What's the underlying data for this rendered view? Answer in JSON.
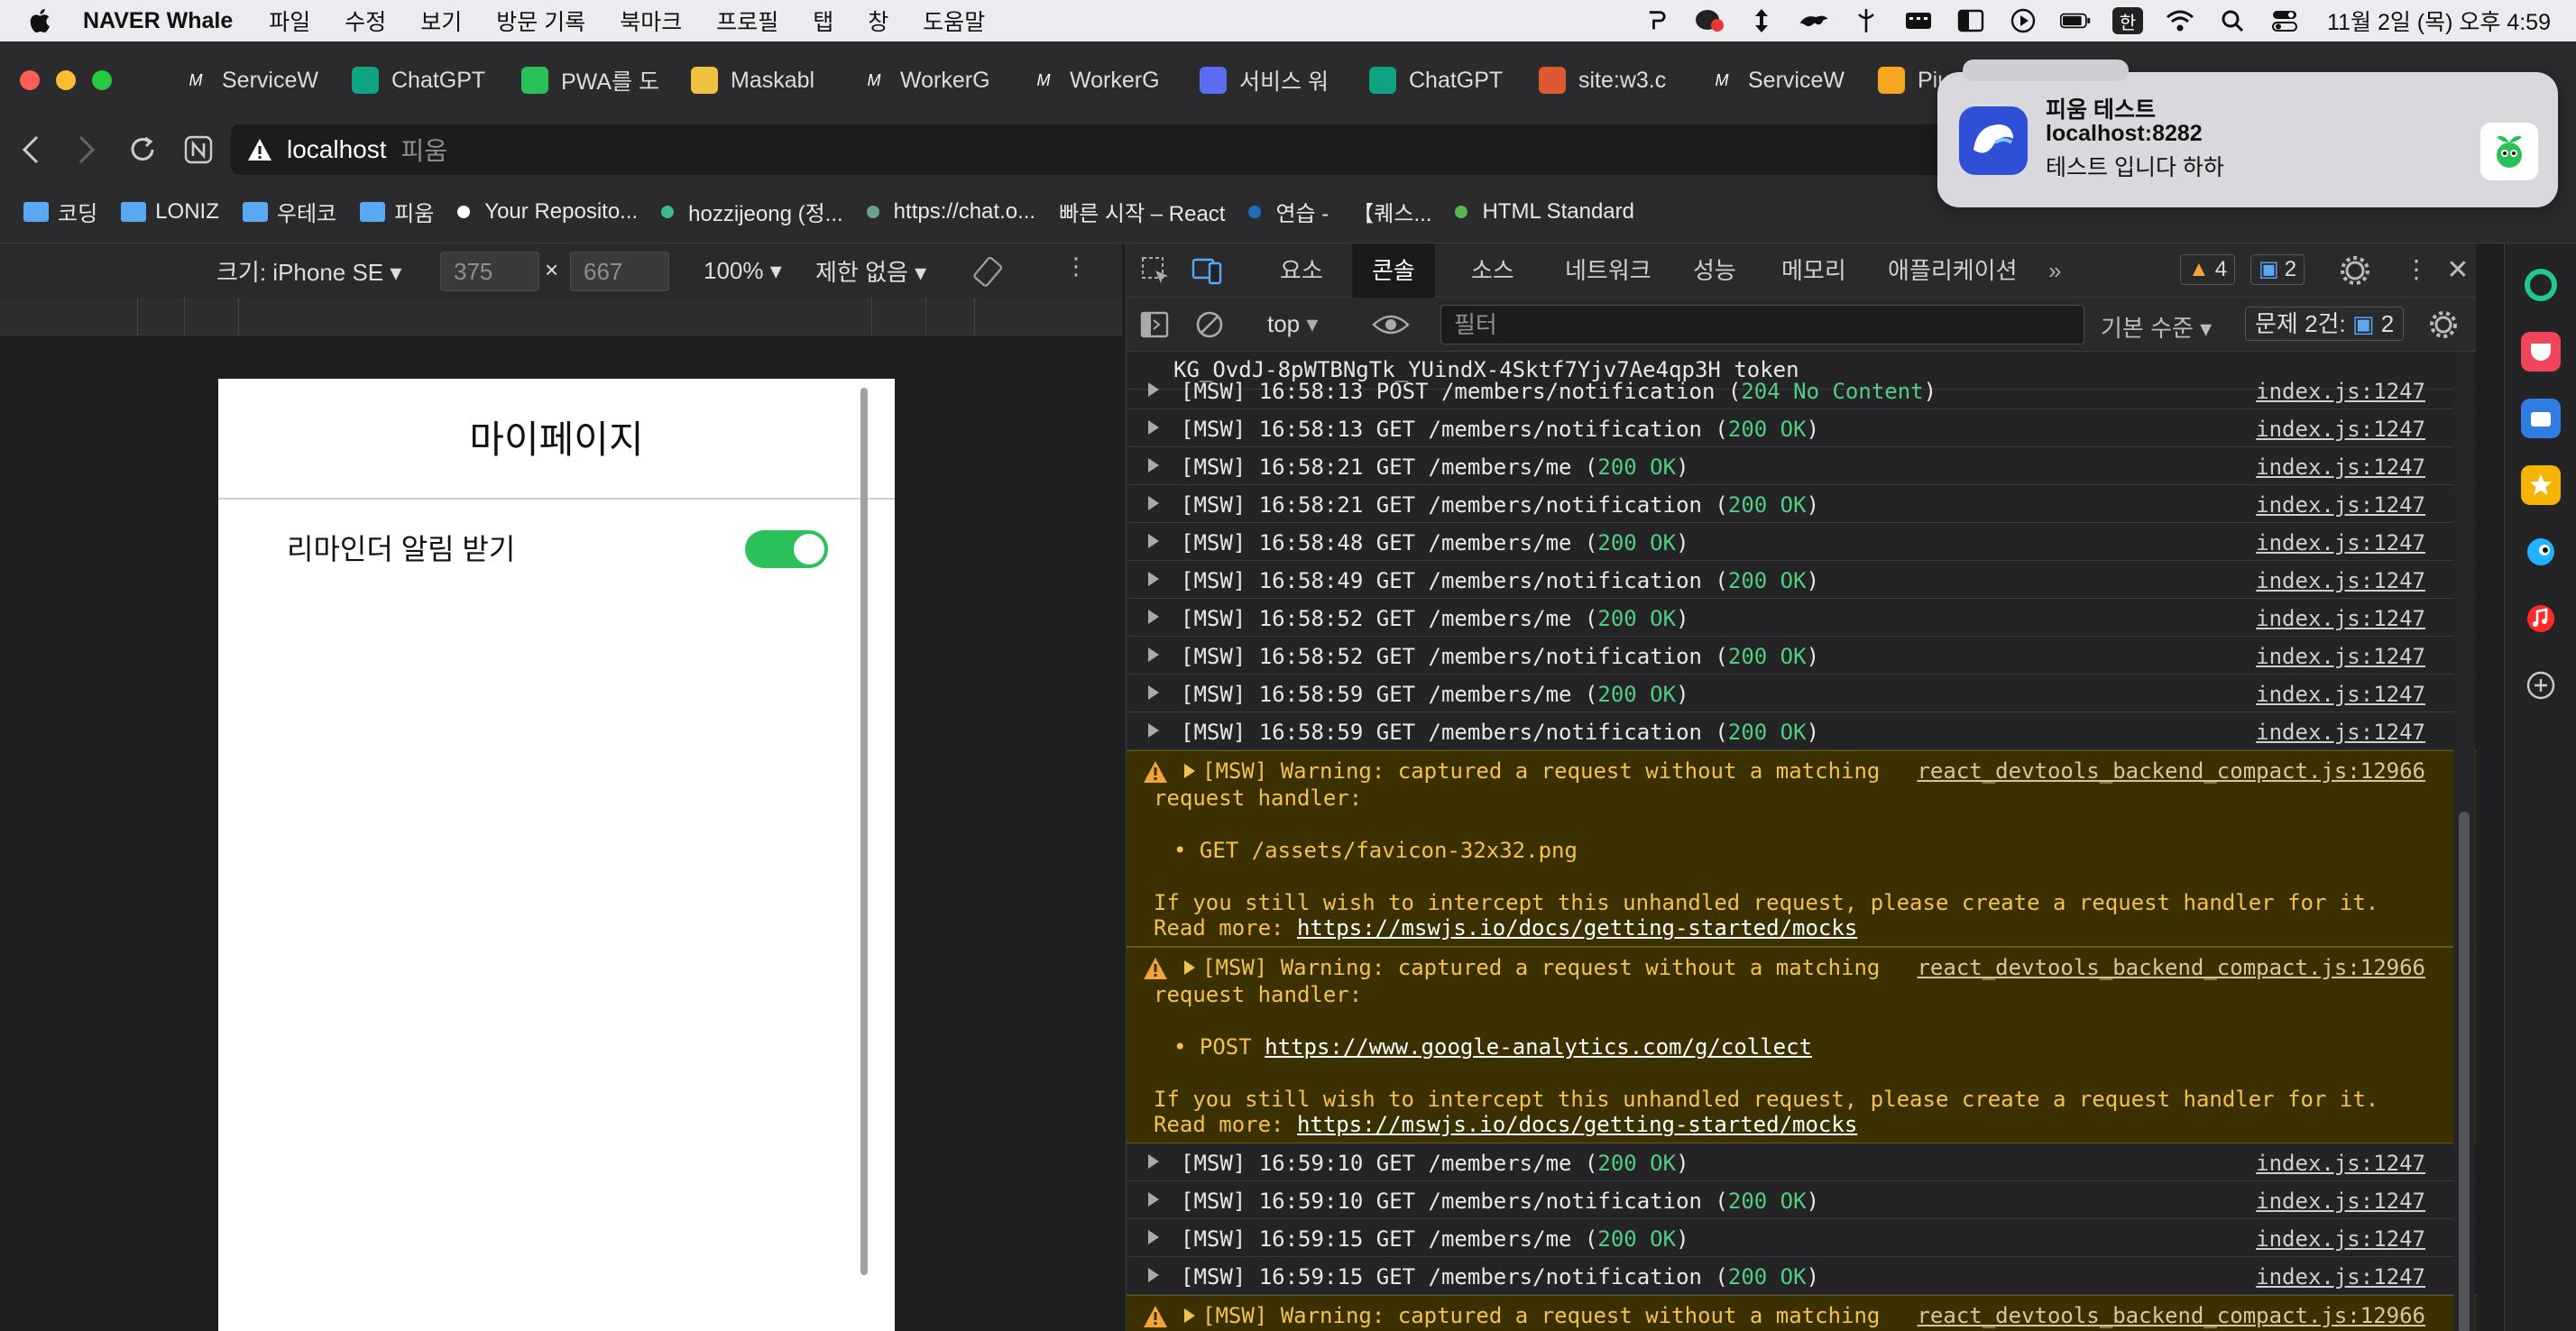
{
  "menubar": {
    "app_name": "NAVER Whale",
    "items": [
      "파일",
      "수정",
      "보기",
      "방문 기록",
      "북마크",
      "프로필",
      "탭",
      "창",
      "도움말"
    ],
    "clock": "11월 2일 (목) 오후 4:59",
    "ime": "한"
  },
  "tabs": [
    {
      "label": "ServiceW",
      "icon": "workerg-logo-icon",
      "color": "#2b2b2e"
    },
    {
      "label": "ChatGPT",
      "icon": "chatgpt-icon",
      "color": "#10a37f"
    },
    {
      "label": "PWA를 도",
      "icon": "pium-icon",
      "color": "#2bc15a"
    },
    {
      "label": "Maskabl",
      "icon": "maskable-icon",
      "color": "#f0c040"
    },
    {
      "label": "WorkerG",
      "icon": "workerg-logo-icon",
      "color": "#2b2b2e"
    },
    {
      "label": "WorkerG",
      "icon": "workerg-logo-icon",
      "color": "#2b2b2e"
    },
    {
      "label": "서비스 워",
      "icon": "arrow-logo-icon",
      "color": "#5a6cf0"
    },
    {
      "label": "ChatGPT",
      "icon": "chatgpt-icon",
      "color": "#10a37f"
    },
    {
      "label": "site:w3.c",
      "icon": "duckduckgo-icon",
      "color": "#de5833"
    },
    {
      "label": "ServiceW",
      "icon": "workerg-logo-icon",
      "color": "#2b2b2e"
    },
    {
      "label": "Pium - ",
      "icon": "firebase-icon",
      "color": "#f5a623"
    }
  ],
  "address": {
    "host": "localhost",
    "title": "피움"
  },
  "bookmarks": [
    {
      "label": "코딩",
      "type": "folder"
    },
    {
      "label": "LONIZ",
      "type": "folder"
    },
    {
      "label": "우테코",
      "type": "folder"
    },
    {
      "label": "피움",
      "type": "folder"
    },
    {
      "label": "Your Reposito...",
      "type": "dot",
      "color": "#ffffff"
    },
    {
      "label": "hozzijeong (정...",
      "type": "dot",
      "color": "#3fb98a"
    },
    {
      "label": "https://chat.o...",
      "type": "dot",
      "color": "#6aa28f"
    },
    {
      "label": "빠른 시작 – React",
      "type": "none"
    },
    {
      "label": "연습 - ",
      "type": "dot",
      "color": "#1e6fb8"
    },
    {
      "label": "【퀘스...",
      "type": "none"
    },
    {
      "label": "HTML Standard",
      "type": "dot",
      "color": "#5ab552"
    }
  ],
  "notification": {
    "title": "피움 테스트",
    "subtitle": "localhost:8282",
    "body": "테스트 입니다 하하"
  },
  "device_toolbar": {
    "size_label": "크기: iPhone SE",
    "width": "375",
    "height": "667",
    "zoom": "100%",
    "throttle": "제한 없음"
  },
  "phone": {
    "title": "마이페이지",
    "reminder_label": "리마인더 알림 받기",
    "reminder_on": true
  },
  "devtools": {
    "tabs": [
      "요소",
      "콘솔",
      "소스",
      "네트워크",
      "성능",
      "메모리",
      "애플리케이션"
    ],
    "active_tab": "콘솔",
    "warn_count": "4",
    "msg_count": "2",
    "context": "top",
    "filter_placeholder": "필터",
    "level": "기본 수준",
    "issues_label": "문제 2건:",
    "issues_count": "2"
  },
  "console": {
    "token_line": "KG_OvdJ-8pWTBNgTk_YUindX-4Sktf7Yjv7Ae4qp3H token",
    "logs_a": [
      {
        "text": "[MSW] 16:58:13 POST /members/notification (",
        "status": "204 No Content",
        "tail": ")",
        "src": "index.js:1247"
      },
      {
        "text": "[MSW] 16:58:13 GET /members/notification (",
        "status": "200 OK",
        "tail": ")",
        "src": "index.js:1247"
      },
      {
        "text": "[MSW] 16:58:21 GET /members/me (",
        "status": "200 OK",
        "tail": ")",
        "src": "index.js:1247"
      },
      {
        "text": "[MSW] 16:58:21 GET /members/notification (",
        "status": "200 OK",
        "tail": ")",
        "src": "index.js:1247"
      },
      {
        "text": "[MSW] 16:58:48 GET /members/me (",
        "status": "200 OK",
        "tail": ")",
        "src": "index.js:1247"
      },
      {
        "text": "[MSW] 16:58:49 GET /members/notification (",
        "status": "200 OK",
        "tail": ")",
        "src": "index.js:1247"
      },
      {
        "text": "[MSW] 16:58:52 GET /members/me (",
        "status": "200 OK",
        "tail": ")",
        "src": "index.js:1247"
      },
      {
        "text": "[MSW] 16:58:52 GET /members/notification (",
        "status": "200 OK",
        "tail": ")",
        "src": "index.js:1247"
      },
      {
        "text": "[MSW] 16:58:59 GET /members/me (",
        "status": "200 OK",
        "tail": ")",
        "src": "index.js:1247"
      },
      {
        "text": "[MSW] 16:58:59 GET /members/notification (",
        "status": "200 OK",
        "tail": ")",
        "src": "index.js:1247"
      }
    ],
    "warn1": {
      "line1": "[MSW] Warning: captured a request without a matching",
      "line2": "request handler:",
      "bullet": "• GET /assets/favicon-32x32.png",
      "bullet_link": "",
      "line3": "If you still wish to intercept this unhandled request, please create a request handler for it.",
      "read_more": "Read more: ",
      "link": "https://mswjs.io/docs/getting-started/mocks",
      "src": "react_devtools_backend_compact.js:12966"
    },
    "warn2": {
      "line1": "[MSW] Warning: captured a request without a matching",
      "line2": "request handler:",
      "bullet": "• POST ",
      "bullet_link": "https://www.google-analytics.com/g/collect",
      "line3": "If you still wish to intercept this unhandled request, please create a request handler for it.",
      "read_more": "Read more: ",
      "link": "https://mswjs.io/docs/getting-started/mocks",
      "src": "react_devtools_backend_compact.js:12966"
    },
    "logs_b": [
      {
        "text": "[MSW] 16:59:10 GET /members/me (",
        "status": "200 OK",
        "tail": ")",
        "src": "index.js:1247"
      },
      {
        "text": "[MSW] 16:59:10 GET /members/notification (",
        "status": "200 OK",
        "tail": ")",
        "src": "index.js:1247"
      },
      {
        "text": "[MSW] 16:59:15 GET /members/me (",
        "status": "200 OK",
        "tail": ")",
        "src": "index.js:1247"
      },
      {
        "text": "[MSW] 16:59:15 GET /members/notification (",
        "status": "200 OK",
        "tail": ")",
        "src": "index.js:1247"
      }
    ],
    "warn3_line1": "[MSW] Warning: captured a request without a matching",
    "warn3_src": "react_devtools_backend_compact.js:12966"
  },
  "colors": {
    "toggle_on": "#2bc15a",
    "status_ok": "#4fd07e",
    "warning_text": "#f2c14e",
    "warning_bg": "#3b3100"
  }
}
